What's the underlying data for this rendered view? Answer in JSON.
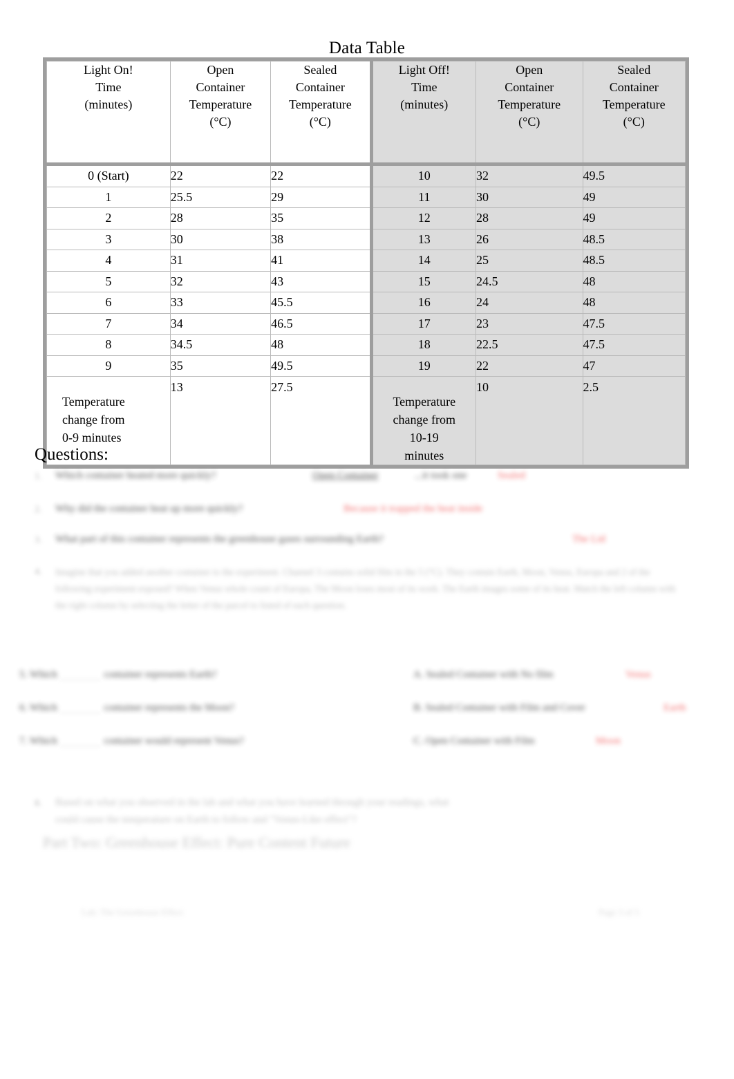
{
  "document": {
    "title": "Data Table",
    "questions_heading": "Questions:"
  },
  "table": {
    "headers_left": [
      "Light On!\nTime\n(minutes)",
      "Open\nContainer\nTemperature\n(°C)",
      "Sealed\nContainer\nTemperature\n(°C)"
    ],
    "headers_right": [
      "Light Off!\nTime\n(minutes)",
      "Open\nContainer\nTemperature\n(°C)",
      "Sealed\nContainer\nTemperature\n(°C)"
    ],
    "header_left_time": "Light On!",
    "header_left_time_l2": "Time",
    "header_left_time_l3": "(minutes)",
    "header_right_time": "Light Off!",
    "header_right_time_l2": "Time",
    "header_right_time_l3": "(minutes)",
    "header_open_l1": "Open",
    "header_open_l2": "Container",
    "header_open_l3": "Temperature",
    "header_open_l4": "(°C)",
    "header_sealed_l1": "Sealed",
    "header_sealed_l2": "Container",
    "header_sealed_l3": "Temperature",
    "header_sealed_l4": "(°C)",
    "rows": [
      {
        "t_on": "0 (Start)",
        "open_on": "22",
        "sealed_on": "22",
        "t_off": "10",
        "open_off": "32",
        "sealed_off": "49.5"
      },
      {
        "t_on": "1",
        "open_on": "25.5",
        "sealed_on": "29",
        "t_off": "11",
        "open_off": "30",
        "sealed_off": "49"
      },
      {
        "t_on": "2",
        "open_on": "28",
        "sealed_on": "35",
        "t_off": "12",
        "open_off": "28",
        "sealed_off": "49"
      },
      {
        "t_on": "3",
        "open_on": "30",
        "sealed_on": "38",
        "t_off": "13",
        "open_off": "26",
        "sealed_off": "48.5"
      },
      {
        "t_on": "4",
        "open_on": "31",
        "sealed_on": "41",
        "t_off": "14",
        "open_off": "25",
        "sealed_off": "48.5"
      },
      {
        "t_on": "5",
        "open_on": "32",
        "sealed_on": "43",
        "t_off": "15",
        "open_off": "24.5",
        "sealed_off": "48"
      },
      {
        "t_on": "6",
        "open_on": "33",
        "sealed_on": "45.5",
        "t_off": "16",
        "open_off": "24",
        "sealed_off": "48"
      },
      {
        "t_on": "7",
        "open_on": "34",
        "sealed_on": "46.5",
        "t_off": "17",
        "open_off": "23",
        "sealed_off": "47.5"
      },
      {
        "t_on": "8",
        "open_on": "34.5",
        "sealed_on": "48",
        "t_off": "18",
        "open_off": "22.5",
        "sealed_off": "47.5"
      },
      {
        "t_on": "9",
        "open_on": "35",
        "sealed_on": "49.5",
        "t_off": "19",
        "open_off": "22",
        "sealed_off": "47"
      }
    ],
    "change_row": {
      "label_left_l1": "Temperature",
      "label_left_l2": "change from",
      "label_left_l3": "0-9 minutes",
      "open_left": "13",
      "sealed_left": "27.5",
      "label_right_l1": "Temperature",
      "label_right_l2": "change from",
      "label_right_l3": "10-19",
      "label_right_l4": "minutes",
      "open_right": "10",
      "sealed_right": "2.5"
    }
  },
  "chart_data": {
    "type": "table",
    "title": "Data Table",
    "xlabel": "Time (minutes)",
    "ylabel": "Temperature (°C)",
    "categories": [
      "0 (Start)",
      "1",
      "2",
      "3",
      "4",
      "5",
      "6",
      "7",
      "8",
      "9",
      "10",
      "11",
      "12",
      "13",
      "14",
      "15",
      "16",
      "17",
      "18",
      "19"
    ],
    "series": [
      {
        "name": "Open Container Temperature (°C)",
        "values": [
          22,
          25.5,
          28,
          30,
          31,
          32,
          33,
          34,
          34.5,
          35,
          32,
          30,
          28,
          26,
          25,
          24.5,
          24,
          23,
          22.5,
          22
        ]
      },
      {
        "name": "Sealed Container Temperature (°C)",
        "values": [
          22,
          29,
          35,
          38,
          41,
          43,
          45.5,
          46.5,
          48,
          49.5,
          49.5,
          49,
          49,
          48.5,
          48.5,
          48,
          48,
          47.5,
          47.5,
          47
        ]
      }
    ],
    "phases": [
      {
        "name": "Light On!",
        "time_range": [
          0,
          9
        ],
        "open_change": 13,
        "sealed_change": 27.5
      },
      {
        "name": "Light Off!",
        "time_range": [
          10,
          19
        ],
        "open_change": 10,
        "sealed_change": 2.5
      }
    ],
    "grid": true,
    "legend": "top"
  },
  "questions": {
    "q1": {
      "number": "1.",
      "text": "Which container heated more quickly?",
      "answer_blank": "Open Container",
      "tail": "...it took one",
      "highlight": "Sealed"
    },
    "q2": {
      "number": "2.",
      "text": "Why did the container heat up more quickly?",
      "highlight": "Because it trapped the heat inside"
    },
    "q3": {
      "number": "3.",
      "text": "What part of this container represents the greenhouse gases surrounding Earth?",
      "highlight": "The Lid"
    },
    "q4": {
      "number": "4.",
      "paragraph": "Imagine that you added another container to the experiment. Channel 3 contains solid film in the 5 (°C). They contain Earth, Moon, Venus, Europa and 2 of the following experiment exposed? When Venus whole count of Europa, The Moon loses most of its work. The Earth images some of its heat. Match the left column with the right column by selecting the letter of the parcel to listed of each question."
    },
    "q5": {
      "number": "5.",
      "left_prefix": "Which",
      "left_suffix": "container represents Earth?",
      "right_prefix": "A.",
      "right_text": "Sealed Container with No film",
      "highlight": "Venus"
    },
    "q6": {
      "number": "6.",
      "left_prefix": "Which",
      "left_suffix": "container represents the Moon?",
      "right_prefix": "B.",
      "right_text": "Sealed Container with Film and Cover",
      "highlight": "Earth"
    },
    "q7": {
      "number": "7.",
      "left_prefix": "Which",
      "left_suffix": "container would represent Venus?",
      "right_prefix": "C.",
      "right_text": "Open Container with Film",
      "highlight": "Moon"
    },
    "q8": {
      "number": "8.",
      "line1": "Based on what you observed in the lab and what you have learned through your readings, what",
      "line2": "could cause the temperature on Earth to follow and \"Venus-Like effect\"?"
    }
  },
  "bottom_section": {
    "heading": "Part Two: Greenhouse Effect: Pure Content Future"
  },
  "footer": {
    "left": "Lab: The Greenhouse Effect",
    "right": "Page 3 of 5"
  },
  "colors": {
    "highlight_red": "#f26b6b",
    "table_border": "#9e9e9e",
    "table_shade": "#dcdcdc",
    "page_background": "#ffffff"
  }
}
